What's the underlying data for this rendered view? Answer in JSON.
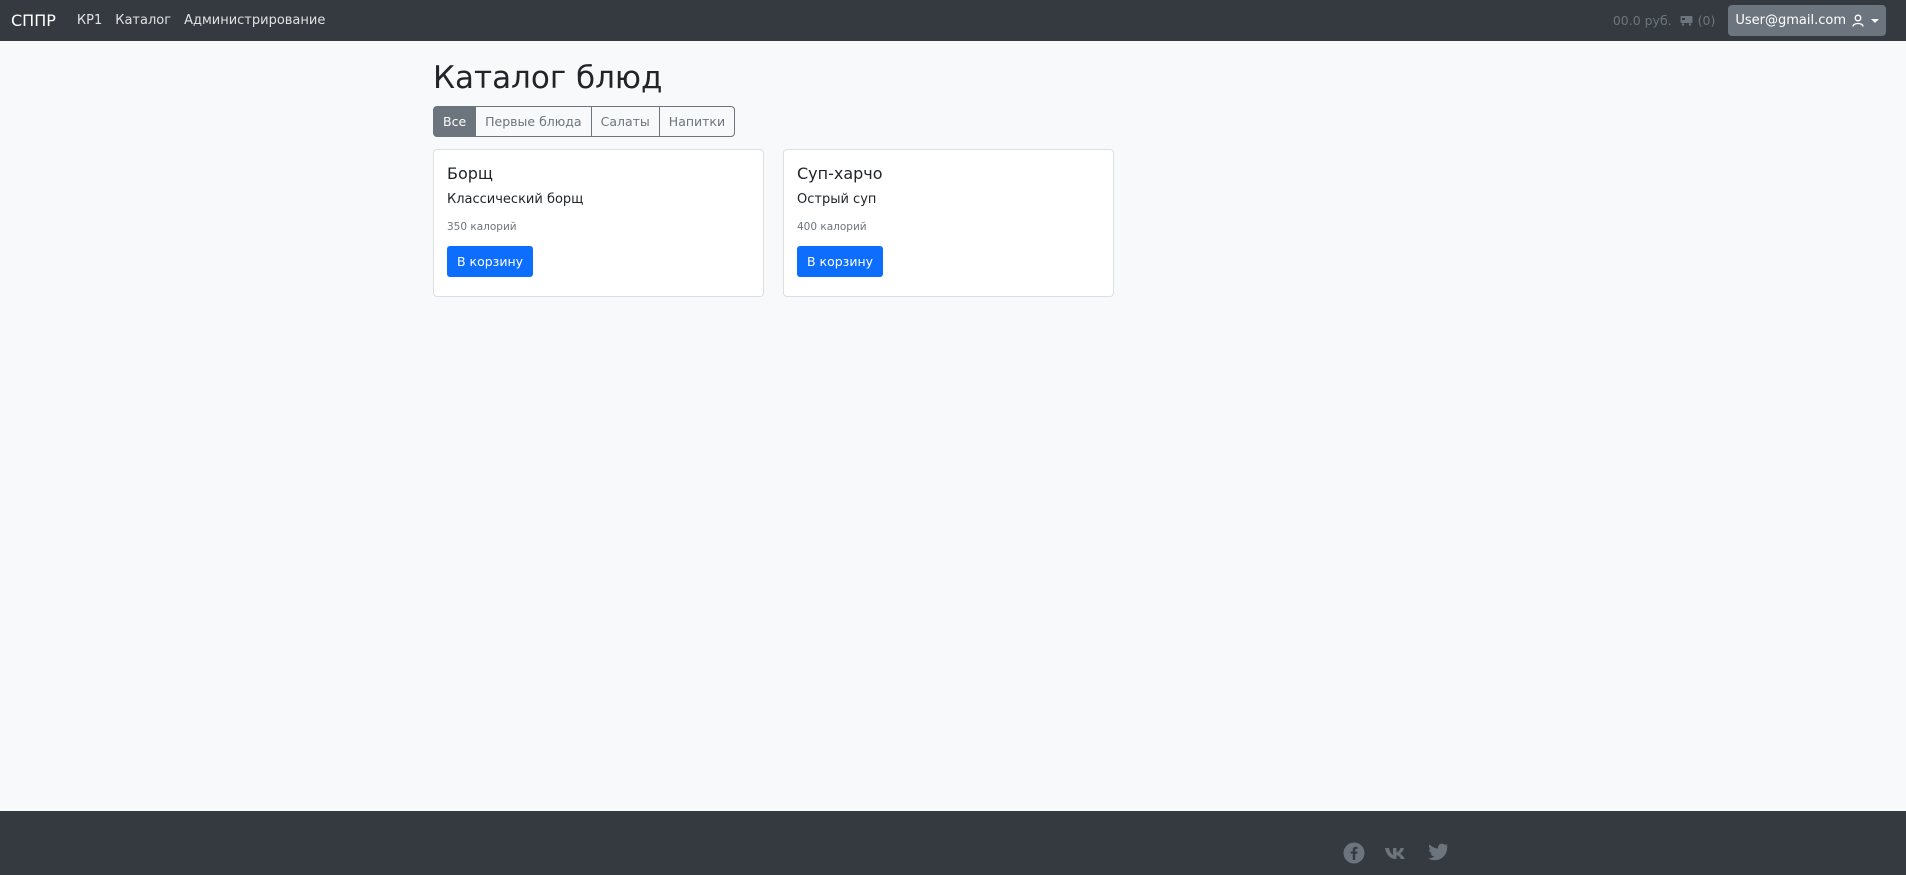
{
  "navbar": {
    "brand": "СППР",
    "links": [
      "КР1",
      "Каталог",
      "Администрирование"
    ],
    "cart_total": "00.0 руб.",
    "cart_count": "(0)",
    "user_email": "User@gmail.com"
  },
  "main": {
    "title": "Каталог блюд",
    "filters": [
      "Все",
      "Первые блюда",
      "Салаты",
      "Напитки"
    ],
    "active_filter": "Все",
    "cards": [
      {
        "title": "Борщ",
        "subtitle": "Классический борщ",
        "calories": "350 калорий",
        "button": "В корзину"
      },
      {
        "title": "Суп-харчо",
        "subtitle": "Острый суп",
        "calories": "400 калорий",
        "button": "В корзину"
      }
    ]
  },
  "footer": {
    "social_icons": [
      "facebook-icon",
      "vk-icon",
      "twitter-icon"
    ]
  },
  "colors": {
    "navbar_bg": "#343a40",
    "page_bg": "#f8f9fa",
    "primary": "#0d6efd",
    "secondary": "#6c757d"
  }
}
